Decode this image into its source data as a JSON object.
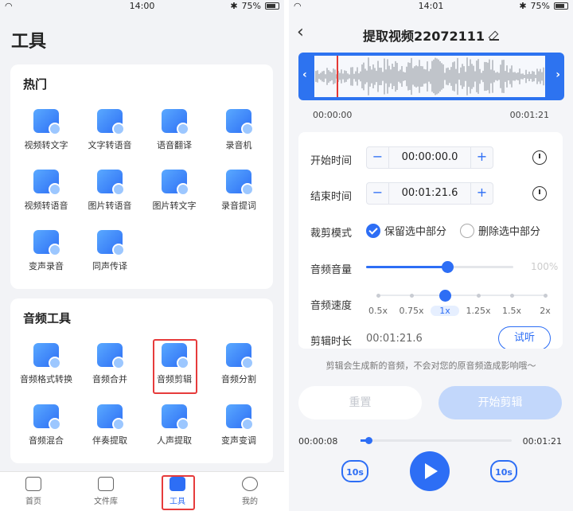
{
  "left_phone": {
    "status": {
      "time": "14:00",
      "battery": "75%"
    },
    "page_title": "工具",
    "hot": {
      "title": "热门",
      "tools": [
        "视频转文字",
        "文字转语音",
        "语音翻译",
        "录音机",
        "视频转语音",
        "图片转语音",
        "图片转文字",
        "录音提词",
        "变声录音",
        "同声传译"
      ]
    },
    "audio": {
      "title": "音频工具",
      "tools": [
        "音频格式转换",
        "音频合并",
        "音频剪辑",
        "音频分割",
        "音频混合",
        "伴奏提取",
        "人声提取",
        "变声变调"
      ],
      "highlighted": "音频剪辑"
    },
    "nav": [
      "首页",
      "文件库",
      "工具",
      "我的"
    ],
    "active_nav": "工具"
  },
  "right_phone": {
    "status": {
      "time": "14:01",
      "battery": "75%"
    },
    "title": "提取视频22072111",
    "wave_start": "00:00:00",
    "wave_end": "00:01:21",
    "start_label": "开始时间",
    "start_value": "00:00:00.0",
    "end_label": "结束时间",
    "end_value": "00:01:21.6",
    "minus": "−",
    "plus": "+",
    "mode_label": "裁剪模式",
    "mode_keep": "保留选中部分",
    "mode_delete": "删除选中部分",
    "volume_label": "音频音量",
    "volume_value": "100%",
    "volume_level": 0.55,
    "speed_label": "音频速度",
    "speeds": [
      "0.5x",
      "0.75x",
      "1x",
      "1.25x",
      "1.5x",
      "2x"
    ],
    "selected_speed": "1x",
    "duration_label": "剪辑时长",
    "duration_value": "00:01:21.6",
    "try_label": "试听",
    "hint": "剪辑会生成新的音频，不会对您的原音频造成影响哦～",
    "reset_label": "重置",
    "start_cut_label": "开始剪辑",
    "play_current": "00:00:08",
    "play_total": "00:01:21",
    "play_progress": 0.05,
    "skip_back": "10s",
    "skip_fwd": "10s",
    "accent_color": "#2d6ef5",
    "highlight_color": "#e63b3b"
  }
}
